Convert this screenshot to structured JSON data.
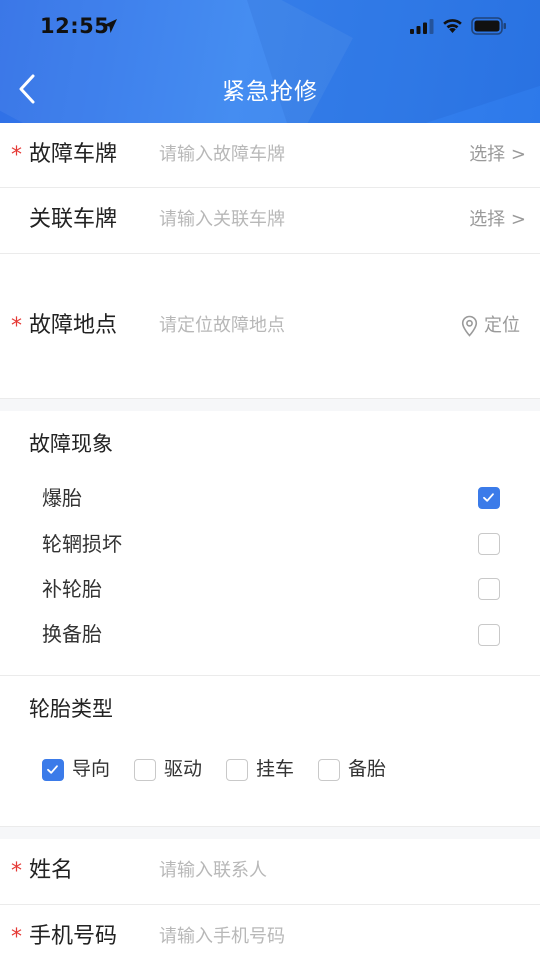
{
  "status_bar": {
    "time": "12:55"
  },
  "nav": {
    "title": "紧急抢修"
  },
  "fields": {
    "fault_plate": {
      "label": "故障车牌",
      "placeholder": "请输入故障车牌",
      "action": "选择 >"
    },
    "linked_plate": {
      "label": "关联车牌",
      "placeholder": "请输入关联车牌",
      "action": "选择 >"
    },
    "fault_location": {
      "label": "故障地点",
      "placeholder": "请定位故障地点",
      "action": "定位"
    },
    "name": {
      "label": "姓名",
      "placeholder": "请输入联系人"
    },
    "phone": {
      "label": "手机号码",
      "placeholder": "请输入手机号码"
    }
  },
  "required_mark": "*",
  "fault_phenomena": {
    "title": "故障现象",
    "options": [
      {
        "label": "爆胎",
        "checked": true
      },
      {
        "label": "轮辋损坏",
        "checked": false
      },
      {
        "label": "补轮胎",
        "checked": false
      },
      {
        "label": "换备胎",
        "checked": false
      }
    ]
  },
  "tire_type": {
    "title": "轮胎类型",
    "options": [
      {
        "label": "导向",
        "checked": true
      },
      {
        "label": "驱动",
        "checked": false
      },
      {
        "label": "挂车",
        "checked": false
      },
      {
        "label": "备胎",
        "checked": false
      }
    ]
  },
  "colors": {
    "header_blue": "#2f6fe6",
    "required_red": "#e53935",
    "check_blue": "#3b7be9"
  }
}
